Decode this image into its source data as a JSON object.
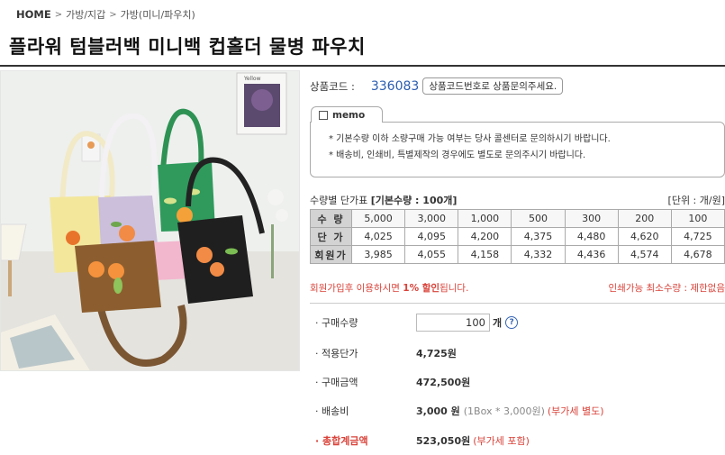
{
  "breadcrumb": {
    "home": "HOME",
    "level1": "가방/지갑",
    "level2": "가방(미니/파우치)"
  },
  "product": {
    "title": "플라워 텀블러백 미니백 컵홀더 물병 파우치"
  },
  "code": {
    "label": "상품코드 :",
    "value": "336083",
    "hint": "상품코드번호로 상품문의주세요."
  },
  "memo": {
    "tab": "memo",
    "lines": [
      "* 기본수량 이하 소량구매 가능 여부는 당사 콜센터로 문의하시기 바랍니다.",
      "* 배송비, 인쇄비, 특별제작의 경우에도 별도로 문의주시기 바랍니다."
    ]
  },
  "price_table": {
    "title": "수량별 단가표",
    "base_qty": "[기본수량 : 100개]",
    "unit_note": "[단위 : 개/원]",
    "rows": [
      {
        "header": "수 량",
        "cells": [
          "5,000",
          "3,000",
          "1,000",
          "500",
          "300",
          "200",
          "100"
        ]
      },
      {
        "header": "단 가",
        "cells": [
          "4,025",
          "4,095",
          "4,200",
          "4,375",
          "4,480",
          "4,620",
          "4,725"
        ]
      },
      {
        "header": "회원가",
        "cells": [
          "3,985",
          "4,055",
          "4,158",
          "4,332",
          "4,436",
          "4,574",
          "4,678"
        ]
      }
    ]
  },
  "notice": {
    "left_prefix": "회원가입후 이용하시면 ",
    "left_bold": "1% 할인",
    "left_suffix": "됩니다.",
    "right": "인쇄가능 최소수량 : 제한없음"
  },
  "order": {
    "qty_label": "· 구매수량",
    "qty_value": "100",
    "qty_unit": "개",
    "help": "?",
    "unit_price_label": "· 적용단가",
    "unit_price": "4,725원",
    "amount_label": "· 구매금액",
    "amount": "472,500원",
    "shipping_label": "· 배송비",
    "shipping": "3,000 원",
    "shipping_detail": "(1Box * 3,000원)",
    "shipping_note": "(부가세 별도)",
    "total_label": "· 총합계금액",
    "total": "523,050원",
    "total_note": "(부가세 포함)"
  },
  "image": {
    "card_text": "Yellow"
  },
  "colors": {
    "accent_blue": "#2a5db0",
    "accent_red": "#d9433a",
    "header_gray": "#d3d3d3"
  }
}
